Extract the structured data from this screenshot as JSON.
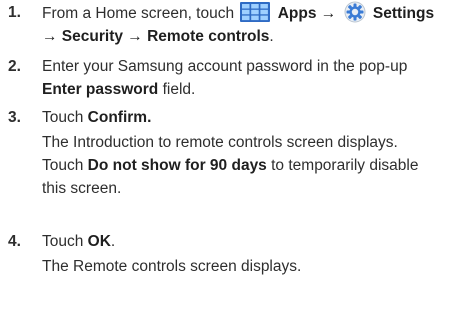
{
  "steps": [
    {
      "number": "1.",
      "line1": {
        "t1": "From a Home screen, touch",
        "b1": "Apps",
        "arrow1": "→",
        "b2": "Settings"
      },
      "line2": {
        "b1": "→ Security → Remote controls",
        "t1": "."
      },
      "icons": [
        "apps-grid-icon",
        "gear-icon"
      ]
    },
    {
      "number": "2.",
      "line1": "Enter your Samsung account password in the pop-up",
      "line2": {
        "b1": "Enter password",
        "t1": " field."
      }
    },
    {
      "number": "3.",
      "line1": {
        "t1": "Touch ",
        "b1": "Confirm."
      },
      "line2": "The Introduction to remote controls screen displays.",
      "line3": {
        "t1": "Touch ",
        "b1": "Do not show for 90 days",
        "t2": " to temporarily disable"
      },
      "line4": "this screen."
    },
    {
      "number": "4.",
      "line1": {
        "t1": "Touch ",
        "b1": "OK",
        "t2": "."
      },
      "line2": "The Remote controls screen displays."
    }
  ],
  "colors": {
    "text": "#2e2e2e",
    "apps_icon_blue": "#2f6bc4",
    "settings_icon_blue": "#3a7bd5"
  }
}
